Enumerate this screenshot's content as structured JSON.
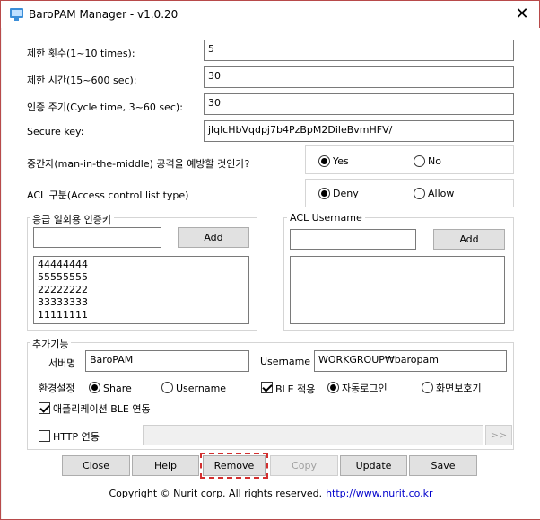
{
  "window": {
    "title": "BaroPAM Manager - v1.0.20",
    "close_glyph": "✕"
  },
  "fields": {
    "limit_count_label": "제한 횟수(1~10 times):",
    "limit_count_value": "5",
    "limit_time_label": "제한 시간(15~600 sec):",
    "limit_time_value": "30",
    "cycle_label": "인증 주기(Cycle time, 3~60 sec):",
    "cycle_value": "30",
    "secure_key_label": "Secure key:",
    "secure_key_value": "jlqlcHbVqdpj7b4PzBpM2DileBvmHFV/"
  },
  "mitm": {
    "label": "중간자(man-in-the-middle) 공격을 예방할 것인가?",
    "yes": "Yes",
    "no": "No",
    "selected": "yes"
  },
  "acl": {
    "label": "ACL 구분(Access control list type)",
    "deny": "Deny",
    "allow": "Allow",
    "selected": "deny"
  },
  "emergency": {
    "title": "응급 일회용 인증키",
    "input_value": "",
    "add_label": "Add",
    "items": [
      "44444444",
      "55555555",
      "22222222",
      "33333333",
      "11111111"
    ]
  },
  "acl_user": {
    "title": "ACL Username",
    "input_value": "",
    "add_label": "Add",
    "items": []
  },
  "extra": {
    "title": "추가기능",
    "server_label": "서버명",
    "server_value": "BaroPAM",
    "username_label": "Username",
    "username_value": "WORKGROUP₩baropam",
    "env_label": "환경설정",
    "share": "Share",
    "username_radio": "Username",
    "env_selected": "share",
    "ble_label": "BLE 적용",
    "ble_checked": true,
    "autologin": "자동로그인",
    "screensaver": "화면보호기",
    "ble_mode_selected": "autologin",
    "app_ble_label": "애플리케이션 BLE 연동",
    "app_ble_checked": true,
    "http_label": "HTTP 연동",
    "http_checked": false,
    "http_value": "",
    "more_label": ">>"
  },
  "buttons": {
    "close": "Close",
    "help": "Help",
    "remove": "Remove",
    "copy": "Copy",
    "update": "Update",
    "save": "Save"
  },
  "footer": {
    "copyright": "Copyright © Nurit corp. All rights reserved.",
    "link": "http://www.nurit.co.kr"
  },
  "colors": {
    "highlight_border": "#d32f2f",
    "link": "#0000cc"
  }
}
